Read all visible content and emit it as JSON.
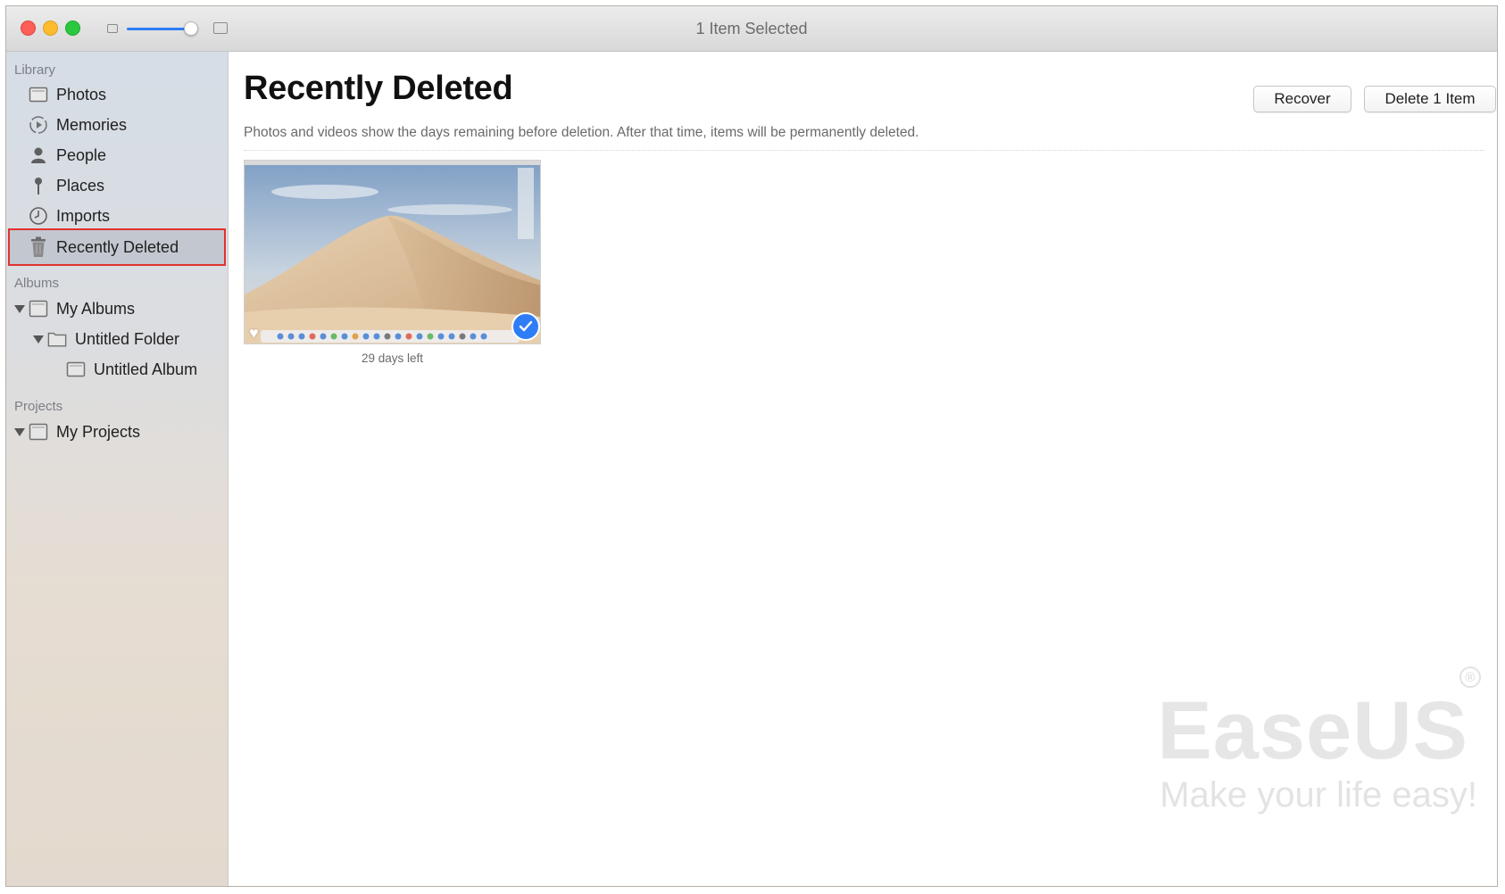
{
  "window": {
    "title": "1 Item Selected",
    "zoom_level_fraction": 0.9
  },
  "sidebar": {
    "sections": [
      {
        "heading": "Library"
      },
      {
        "heading": "Albums"
      },
      {
        "heading": "Projects"
      }
    ],
    "library_items": [
      {
        "label": "Photos",
        "icon": "photos-icon"
      },
      {
        "label": "Memories",
        "icon": "memories-icon"
      },
      {
        "label": "People",
        "icon": "people-icon"
      },
      {
        "label": "Places",
        "icon": "places-icon"
      },
      {
        "label": "Imports",
        "icon": "imports-icon"
      },
      {
        "label": "Recently Deleted",
        "icon": "trash-icon",
        "selected": true
      }
    ],
    "album_items": [
      {
        "label": "My Albums",
        "icon": "album-icon",
        "expanded": true
      },
      {
        "label": "Untitled Folder",
        "icon": "folder-icon",
        "expanded": true
      },
      {
        "label": "Untitled Album",
        "icon": "album-icon"
      }
    ],
    "project_items": [
      {
        "label": "My Projects",
        "icon": "album-icon",
        "expanded": true
      }
    ],
    "highlight_color": "#e0322f"
  },
  "main": {
    "title": "Recently Deleted",
    "subtitle": "Photos and videos show the days remaining before deletion. After that time, items will be permanently deleted.",
    "buttons": {
      "recover": "Recover",
      "delete": "Delete 1 Item"
    },
    "items": [
      {
        "caption": "29 days left",
        "selected": true,
        "favorite_icon": "heart-icon"
      }
    ],
    "accent_color": "#2f7df6"
  },
  "watermark": {
    "brand": "EaseUS",
    "registered": "®",
    "tagline": "Make your life easy!"
  }
}
